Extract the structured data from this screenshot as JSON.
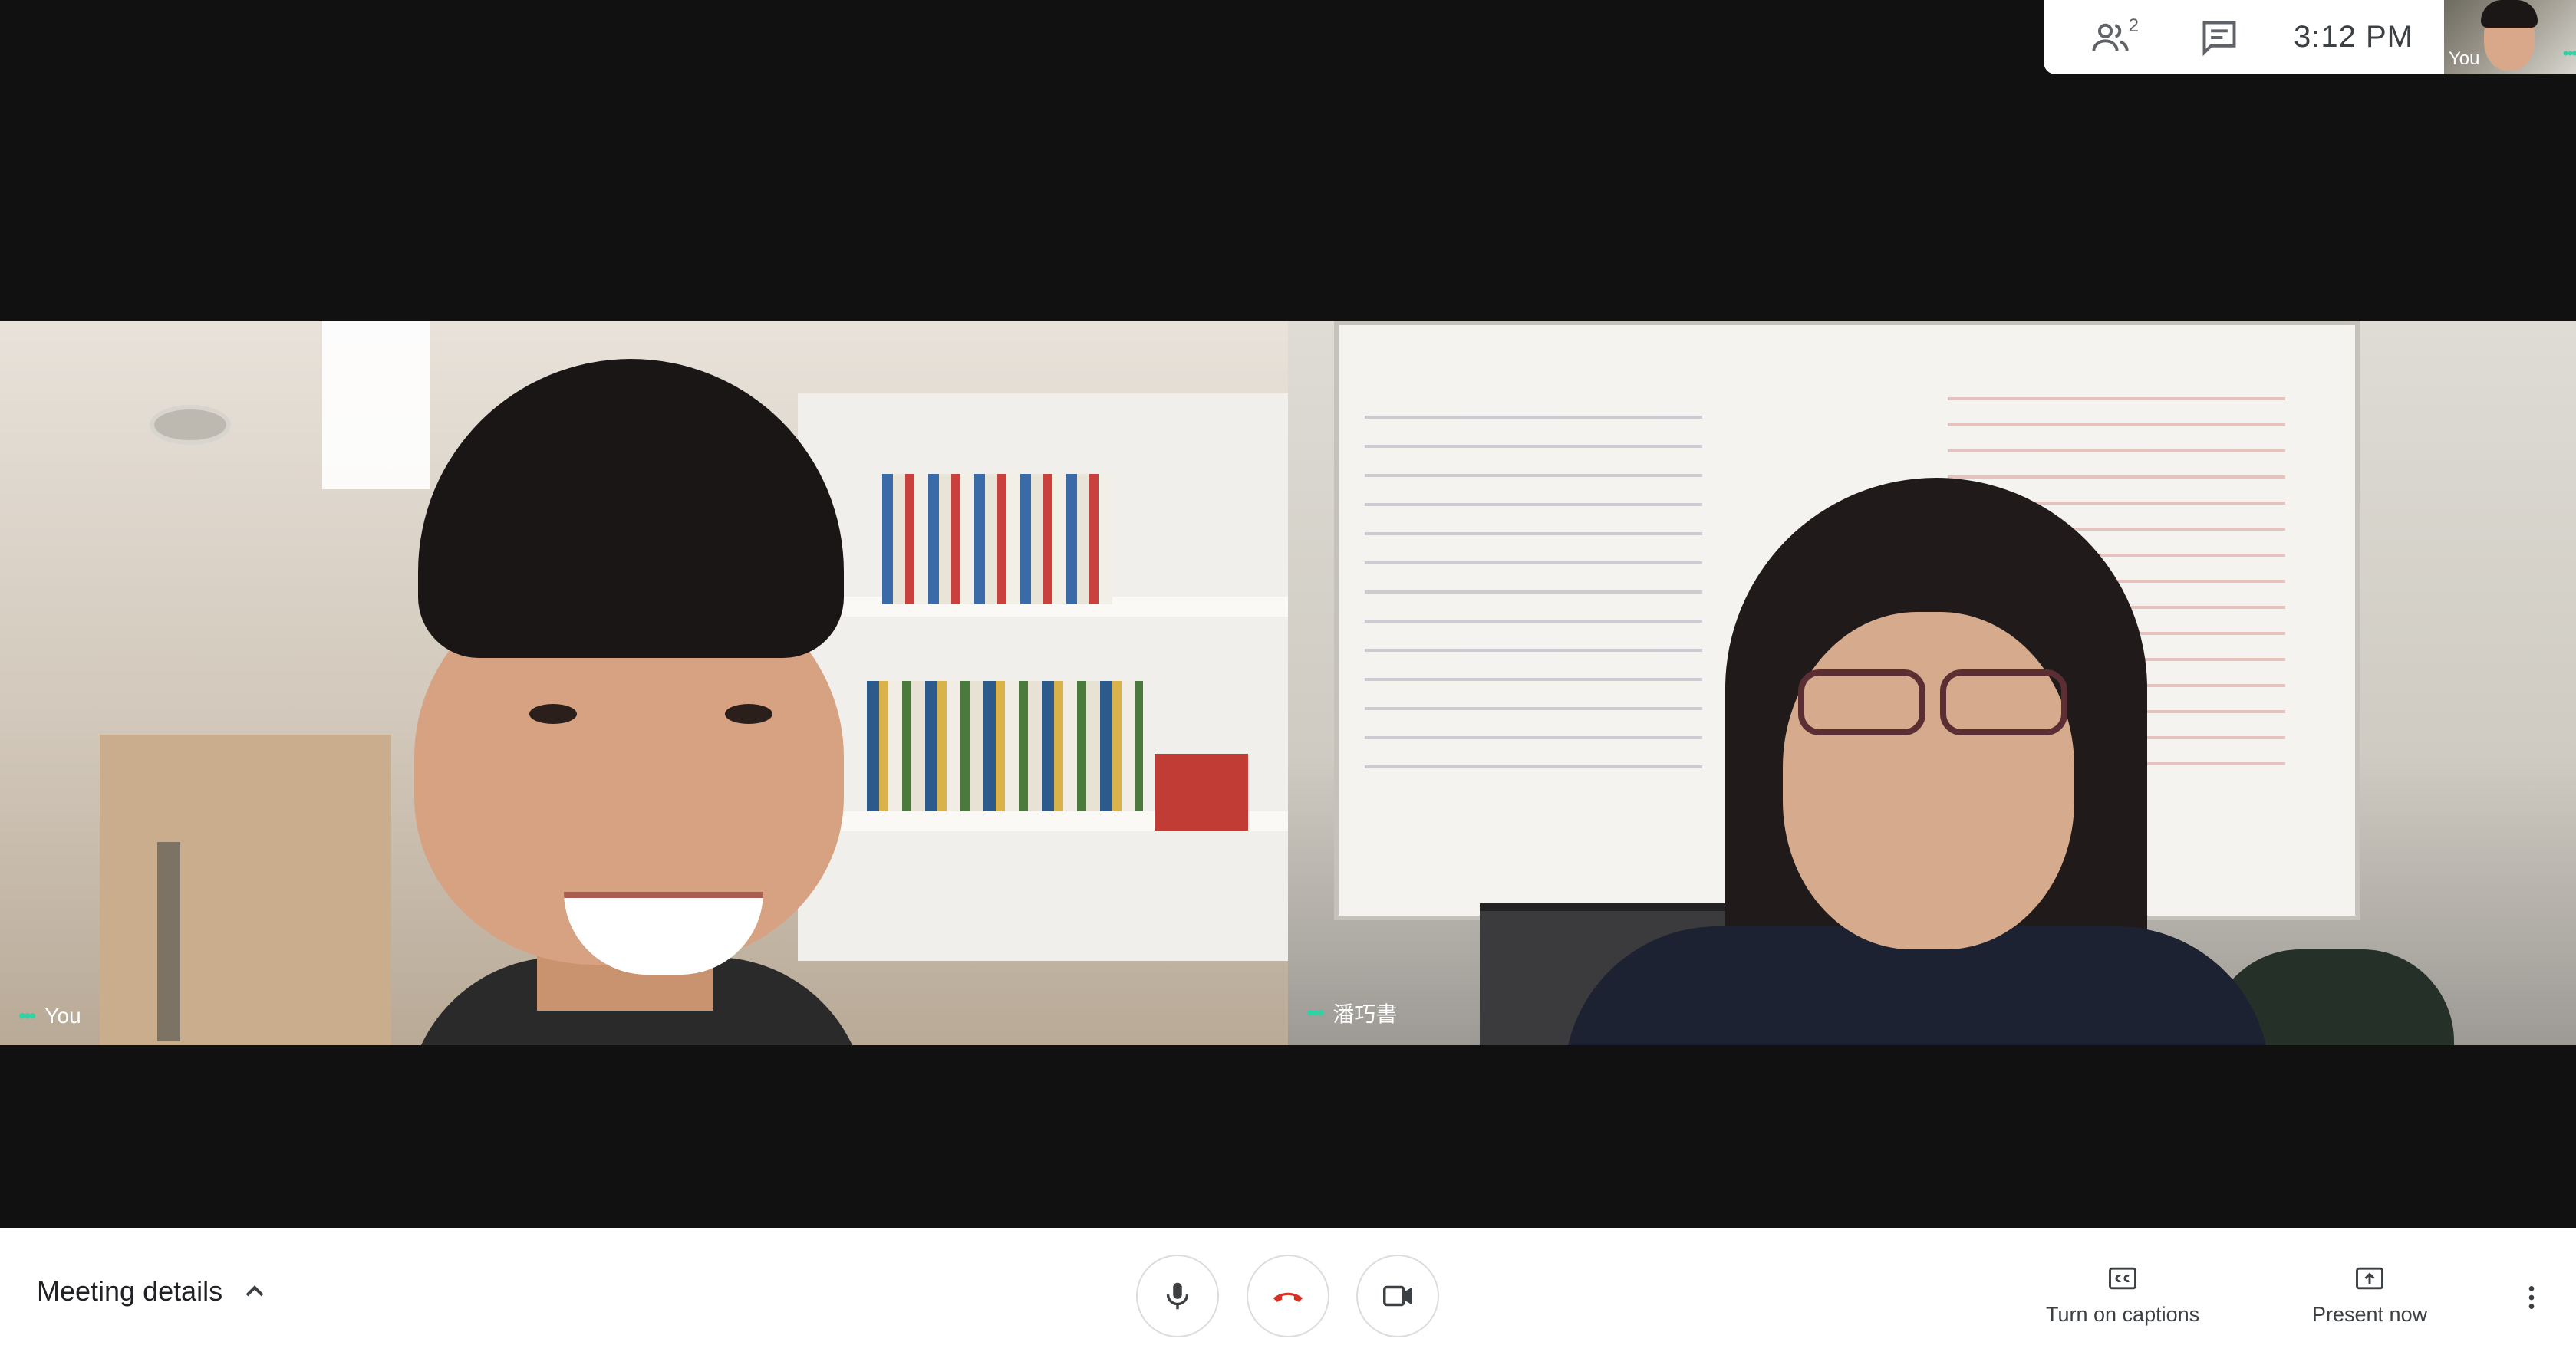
{
  "top_panel": {
    "participant_count": "2",
    "clock": "3:12 PM",
    "self_thumbnail_label": "You"
  },
  "tiles": [
    {
      "name": "You"
    },
    {
      "name": "潘巧書"
    }
  ],
  "bottom_bar": {
    "meeting_details": "Meeting details",
    "captions": "Turn on captions",
    "present": "Present now"
  },
  "icons": {
    "people": "people-icon",
    "chat": "chat-icon",
    "chevron": "chevron-up-icon",
    "mic": "microphone-icon",
    "hangup": "phone-hangup-icon",
    "camera": "video-camera-icon",
    "captions": "closed-captions-icon",
    "present": "present-screen-icon",
    "more": "more-vert-icon"
  },
  "colors": {
    "background": "#111111",
    "hangup_red": "#d93025",
    "speaking_dots": "#2ed3a4"
  }
}
